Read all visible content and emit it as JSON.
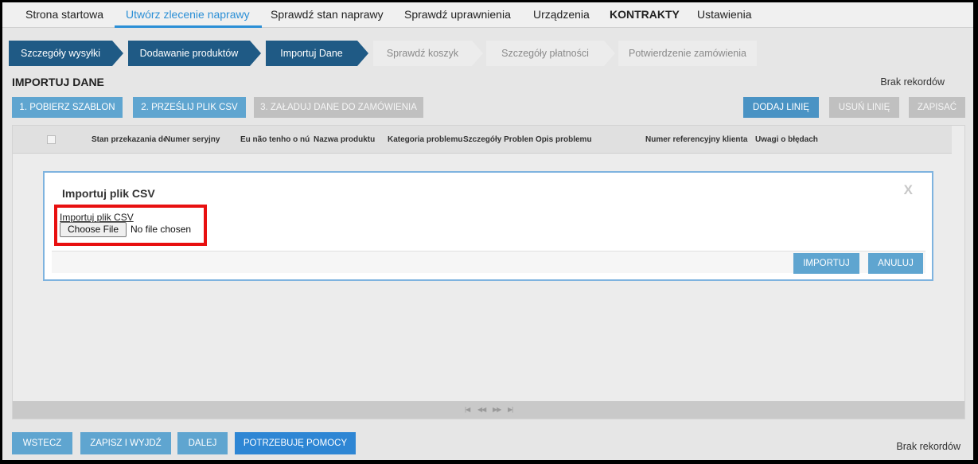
{
  "nav": {
    "items": [
      {
        "label": "Strona startowa"
      },
      {
        "label": "Utwórz zlecenie naprawy"
      },
      {
        "label": "Sprawdź stan naprawy"
      },
      {
        "label": "Sprawdź uprawnienia"
      },
      {
        "label": "Urządzenia"
      },
      {
        "label": "KONTRAKTY"
      },
      {
        "label": "Ustawienia"
      }
    ],
    "active": "Utwórz zlecenie naprawy"
  },
  "steps": [
    {
      "label": "Szczegóły wysyłki",
      "state": "done"
    },
    {
      "label": "Dodawanie produktów",
      "state": "done"
    },
    {
      "label": "Importuj Dane",
      "state": "current"
    },
    {
      "label": "Sprawdź koszyk",
      "state": "todo"
    },
    {
      "label": "Szczegóły płatności",
      "state": "todo"
    },
    {
      "label": "Potwierdzenie zamówienia",
      "state": "todo"
    }
  ],
  "section": {
    "title": "IMPORTUJ DANE",
    "no_records": "Brak rekordów"
  },
  "toolbar": {
    "download_template": "1. POBIERZ SZABLON",
    "upload_csv": "2. PRZEŚLIJ PLIK CSV",
    "load_data": "3. ZAŁADUJ DANE DO ZAMÓWIENIA",
    "add_line": "DODAJ LINIĘ",
    "remove_line": "USUŃ LINIĘ",
    "save": "ZAPISAĆ"
  },
  "grid": {
    "columns": [
      "Stan przekazania do",
      "Numer seryjny",
      "Eu não tenho o número",
      "Nazwa produktu",
      "Kategoria problemu",
      "Szczegóły Problemu",
      "Opis problemu",
      "Numer referencyjny klienta",
      "Uwagi o błędach"
    ],
    "rows": [],
    "pager_icons": [
      "first-page-icon",
      "prev-page-icon",
      "next-page-icon",
      "last-page-icon"
    ]
  },
  "modal": {
    "title": "Importuj plik CSV",
    "close_label": "X",
    "file_label": "Importuj plik CSV",
    "file_button": "Choose File",
    "file_status": "No file chosen",
    "import_button": "IMPORTUJ",
    "cancel_button": "ANULUJ"
  },
  "footer": {
    "back": "WSTECZ",
    "save_exit": "ZAPISZ I WYJDŹ",
    "next": "DALEJ",
    "help": "POTRZEBUJĘ POMOCY",
    "no_records": "Brak rekordów"
  },
  "colors": {
    "accent": "#2b8fd6",
    "step_done": "#1f5a85",
    "button": "#5fa5d0",
    "help_button": "#2e86d4",
    "highlight": "#e81010"
  }
}
